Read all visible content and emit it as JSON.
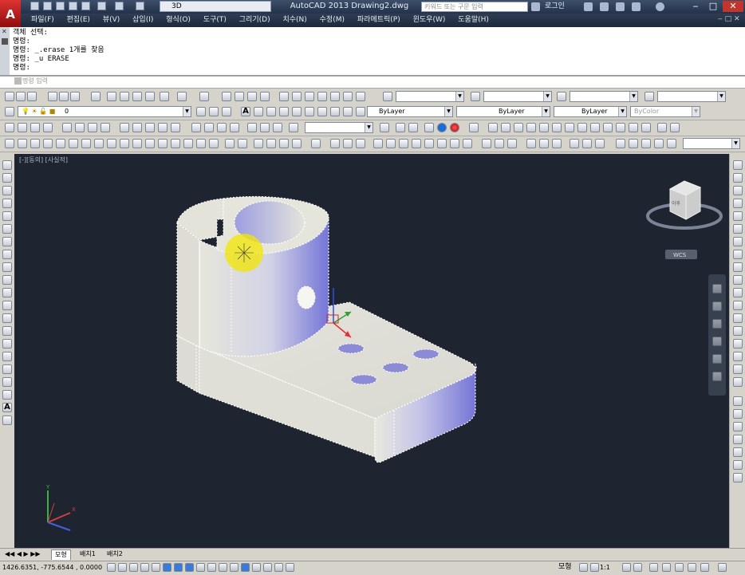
{
  "title_bar": {
    "workspace": "3D",
    "title": "AutoCAD 2013    Drawing2.dwg",
    "search_placeholder": "키워드 또는 구문 입력",
    "login": "로그인"
  },
  "menu": [
    "파일(F)",
    "편집(E)",
    "뷰(V)",
    "삽입(I)",
    "형식(O)",
    "도구(T)",
    "그리기(D)",
    "치수(N)",
    "수정(M)",
    "파라메트릭(P)",
    "윈도우(W)",
    "도움말(H)"
  ],
  "command_history": [
    "객체 선택:",
    "명령:",
    "명령: _.erase 1개를 찾음",
    "명령: _u ERASE",
    "명령:"
  ],
  "command_input_placeholder": "명령 입력",
  "layer_combo": "0",
  "color_combo": "ByLayer",
  "linetype_combo": "ByLayer",
  "lineweight_combo": "ByLayer",
  "plotstyle_combo": "ByColor",
  "viewport_label": "[-][동의] [사실적]",
  "viewcube": {
    "face_label": "이후",
    "wcs_label": "WCS"
  },
  "tabs": [
    "모형",
    "배치1",
    "배치2"
  ],
  "status": {
    "coordinates": "1426.6351, -775.6544 , 0.0000",
    "space": "모형",
    "scale": "1:1"
  },
  "colors": {
    "accent": "#7777dd",
    "viewport_bg": "#1e2530",
    "highlight": "#f2e500"
  }
}
